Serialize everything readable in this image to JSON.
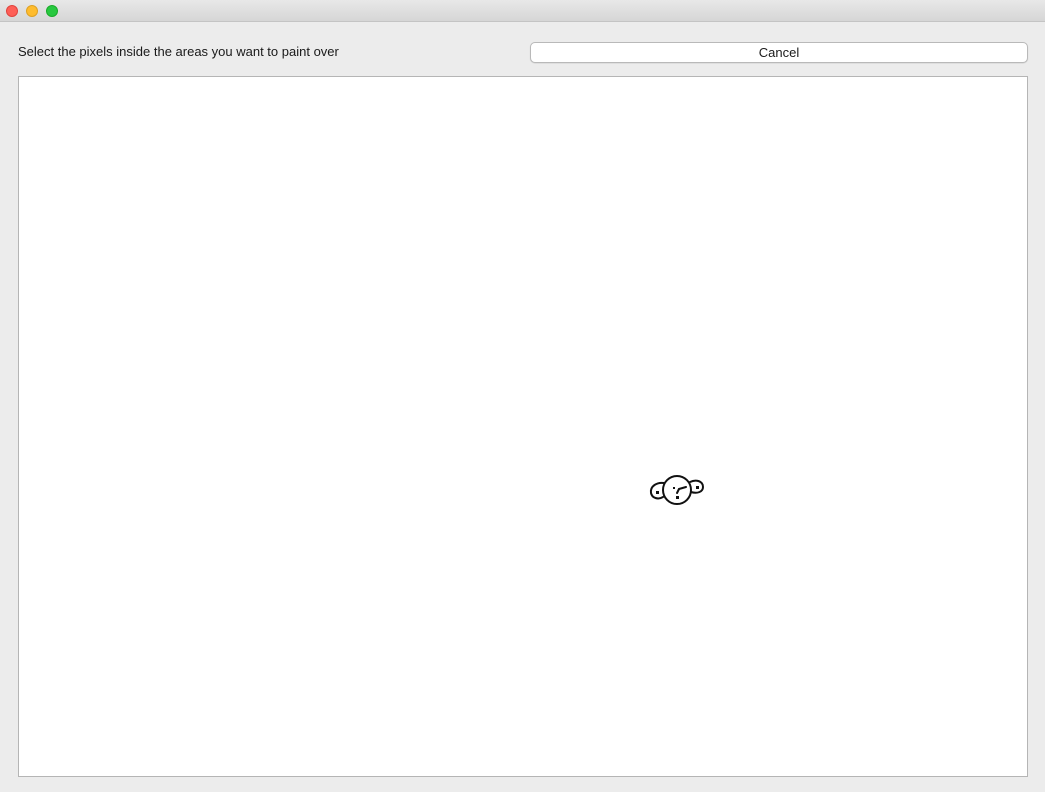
{
  "window": {
    "buttons": {
      "close": "close",
      "minimize": "minimize",
      "zoom": "zoom"
    }
  },
  "header": {
    "instruction": "Select the pixels inside the areas you want to paint over",
    "cancel_label": "Cancel"
  },
  "colors": {
    "close": "#fe5f57",
    "minimize": "#febc2e",
    "zoom": "#28c840",
    "canvas_background": "#ffffff",
    "window_background": "#ececec"
  }
}
